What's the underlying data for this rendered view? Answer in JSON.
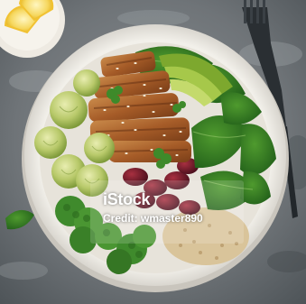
{
  "image": {
    "subject": "Top-down view of a healthy bowl",
    "watermark": {
      "brand": "iStock",
      "credit": "Credit: wmaster890"
    }
  }
}
